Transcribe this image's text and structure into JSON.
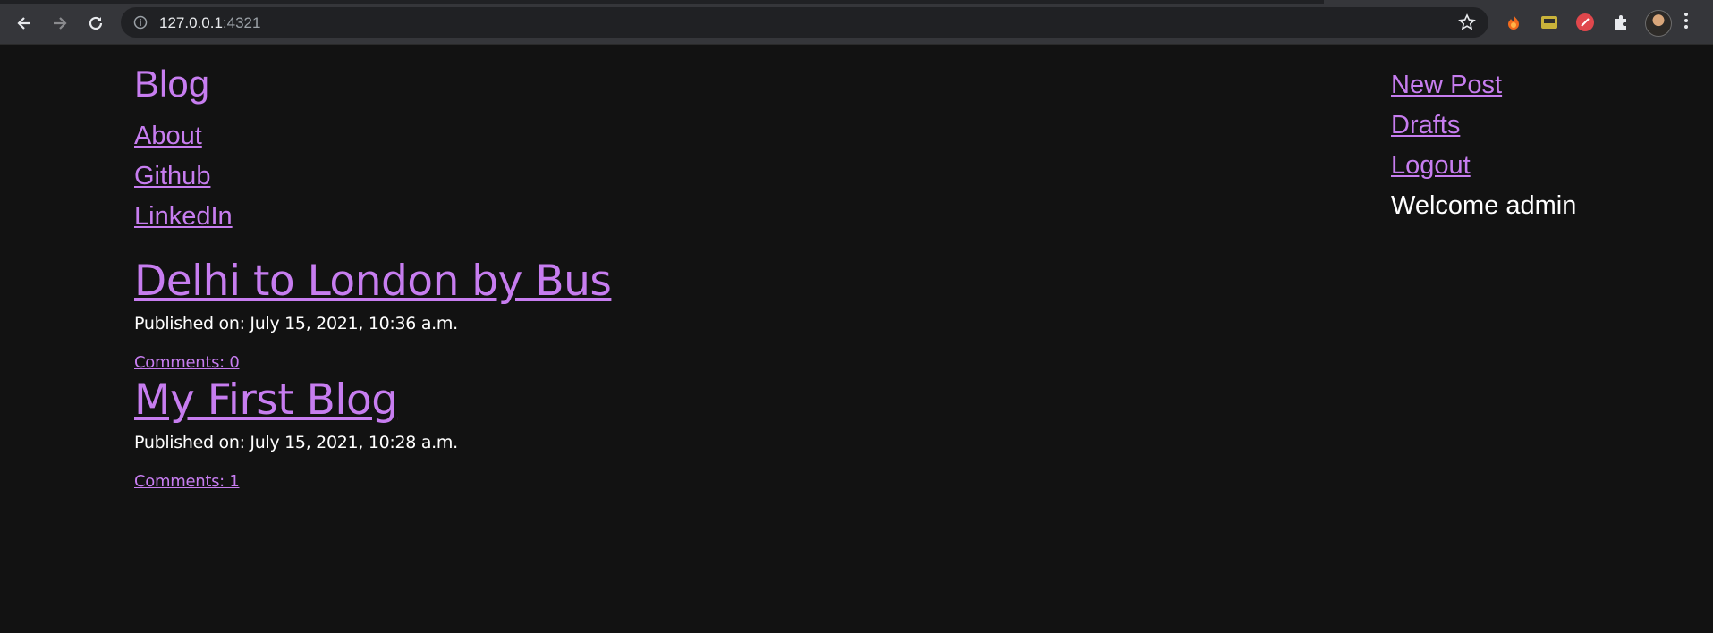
{
  "browser": {
    "url_host": "127.0.0.1",
    "url_port": ":4321"
  },
  "site": {
    "brand": "Blog",
    "left_nav": [
      "About",
      "Github",
      "LinkedIn"
    ],
    "right_nav": [
      "New Post",
      "Drafts",
      "Logout"
    ],
    "welcome": "Welcome admin"
  },
  "posts": [
    {
      "title": "Delhi to London by Bus",
      "published": "Published on: July 15, 2021, 10:36 a.m.",
      "comments": "Comments: 0"
    },
    {
      "title": "My First Blog",
      "published": "Published on: July 15, 2021, 10:28 a.m.",
      "comments": "Comments: 1"
    }
  ],
  "colors": {
    "background": "#121212",
    "link": "#c77df0",
    "text": "#ffffff"
  }
}
